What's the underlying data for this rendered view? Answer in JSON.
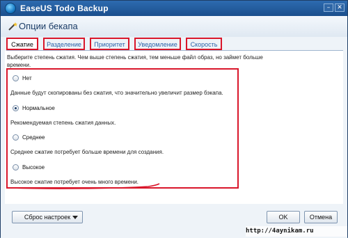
{
  "window": {
    "app_title": "EaseUS Todo Backup",
    "minimize_glyph": "–",
    "close_glyph": "✕"
  },
  "dialog": {
    "title": "Опции бекапа",
    "icon": "wand-icon"
  },
  "tabs": [
    {
      "label": "Сжатие",
      "active": true
    },
    {
      "label": "Разделение",
      "active": false
    },
    {
      "label": "Приоритет",
      "active": false
    },
    {
      "label": "Уведомление",
      "active": false
    },
    {
      "label": "Скорость",
      "active": false
    }
  ],
  "compression": {
    "description": "Выберите степень сжатия. Чем выше степень сжатия, тем меньше файл образ, но займет больше времени.",
    "options": [
      {
        "label": "Нет",
        "description": "Данные будут скопированы без сжатия, что значительно увеличит размер бэкапа.",
        "selected": false
      },
      {
        "label": "Нормальное",
        "description": "Рекомендуемая степень сжатия данных.",
        "selected": true
      },
      {
        "label": "Среднее",
        "description": "Среднее сжатие потребует больше времени для создания.",
        "selected": false
      },
      {
        "label": "Высокое",
        "description": "Высокое сжатие потребует очень много времени.",
        "selected": false
      }
    ]
  },
  "footer": {
    "reset_label": "Сброс настроек",
    "ok_label": "OK",
    "cancel_label": "Отмена"
  },
  "watermark": "http://4aynikam.ru",
  "colors": {
    "title_bar": "#1b4f8c",
    "highlight_border": "#d9162a",
    "tab_text": "#2b62a8"
  }
}
